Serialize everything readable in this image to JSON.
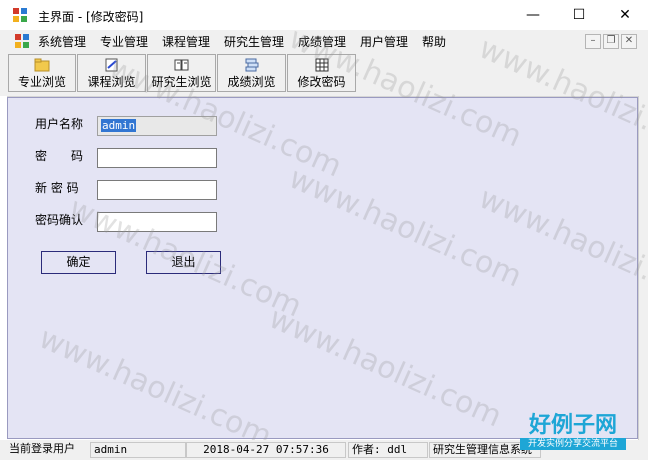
{
  "window": {
    "title": "主界面 - [修改密码]",
    "controls": {
      "minimize": "—",
      "maximize": "☐",
      "close": "✕"
    }
  },
  "menu": {
    "items": [
      "系统管理",
      "专业管理",
      "课程管理",
      "研究生管理",
      "成绩管理",
      "用户管理",
      "帮助"
    ],
    "mdi": {
      "minimize": "–",
      "restore": "❐",
      "close": "✕"
    }
  },
  "toolbar": {
    "buttons": [
      "专业浏览",
      "课程浏览",
      "研究生浏览",
      "成绩浏览",
      "修改密码"
    ]
  },
  "form": {
    "username_label": "用户名称",
    "username_value": "admin",
    "password_label": "密　　码",
    "new_password_label": "新 密 码",
    "confirm_label": "密码确认",
    "ok_button": "确定",
    "exit_button": "退出"
  },
  "statusbar": {
    "current_user_label": "当前登录用户",
    "current_user": "admin",
    "datetime": "2018-04-27 07:57:36",
    "author": "作者: ddl",
    "app_name": "研究生管理信息系统"
  },
  "watermark": {
    "text": "www.haolizi.com",
    "logo_main": "好例子网",
    "logo_sub": "开发实例分享交流平台"
  },
  "colors": {
    "form_bg": "#e4e4f4",
    "selection": "#3276d2",
    "logo": "#1ea6d6"
  }
}
